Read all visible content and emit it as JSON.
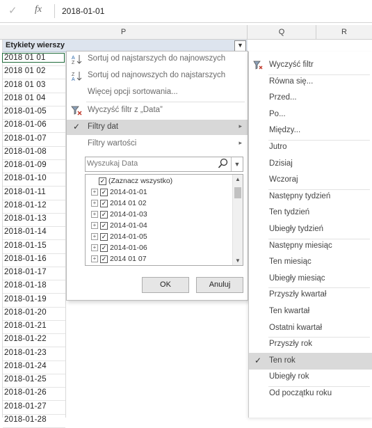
{
  "formula_bar": {
    "cancel_icon": "check-icon",
    "fx": "fx",
    "value": "2018-01-01"
  },
  "columns": [
    "P",
    "Q",
    "R"
  ],
  "pivot": {
    "row_label_header": "Etykiety wierszy"
  },
  "rows": [
    "2018 01 01",
    "2018 01 02",
    "2018 01 03",
    "2018 01 04",
    "2018-01-05",
    "2018-01-06",
    "2018-01-07",
    "2018-01-08",
    "2018-01-09",
    "2018-01-10",
    "2018-01-11",
    "2018-01-12",
    "2018-01-13",
    "2018-01-14",
    "2018-01-15",
    "2018-01-16",
    "2018-01-17",
    "2018-01-18",
    "2018-01-19",
    "2018-01-20",
    "2018-01-21",
    "2018-01-22",
    "2018-01-23",
    "2018-01-24",
    "2018-01-25",
    "2018-01-26",
    "2018-01-27",
    "2018-01-28"
  ],
  "filter_menu": {
    "sort_asc": "Sortuj od najstarszych do najnowszych",
    "sort_desc": "Sortuj od najnowszych do najstarszych",
    "more_sort": "Więcej opcji sortowania...",
    "clear_filter": "Wyczyść filtr z „Data”",
    "date_filters": "Filtry dat",
    "value_filters": "Filtry wartości",
    "search_placeholder": "Wyszukaj Data",
    "tree": [
      {
        "label": "(Zaznacz wszystko)",
        "expand": false
      },
      {
        "label": "2014-01-01",
        "expand": true
      },
      {
        "label": "2014 01 02",
        "expand": true
      },
      {
        "label": "2014-01-03",
        "expand": true
      },
      {
        "label": "2014-01-04",
        "expand": true
      },
      {
        "label": "2014-01-05",
        "expand": true
      },
      {
        "label": "2014-01-06",
        "expand": true
      },
      {
        "label": "2014 01 07",
        "expand": true
      }
    ],
    "ok": "OK",
    "cancel": "Anuluj"
  },
  "date_submenu": {
    "items": [
      {
        "label": "Wyczyść filtr",
        "icon": "clear-filter-icon"
      },
      {
        "label": "Równa się..."
      },
      {
        "label": "Przed..."
      },
      {
        "label": "Po..."
      },
      {
        "label": "Między..."
      },
      {
        "label": "Jutro"
      },
      {
        "label": "Dzisiaj"
      },
      {
        "label": "Wczoraj"
      },
      {
        "label": "Następny tydzień"
      },
      {
        "label": "Ten tydzień"
      },
      {
        "label": "Ubiegły tydzień"
      },
      {
        "label": "Następny miesiąc"
      },
      {
        "label": "Ten miesiąc"
      },
      {
        "label": "Ubiegły miesiąc"
      },
      {
        "label": "Przyszły kwartał"
      },
      {
        "label": "Ten kwartał"
      },
      {
        "label": "Ostatni kwartał"
      },
      {
        "label": "Przyszły rok"
      },
      {
        "label": "Ten rok",
        "checked": true
      },
      {
        "label": "Ubiegły rok"
      },
      {
        "label": "Od początku roku"
      }
    ]
  }
}
